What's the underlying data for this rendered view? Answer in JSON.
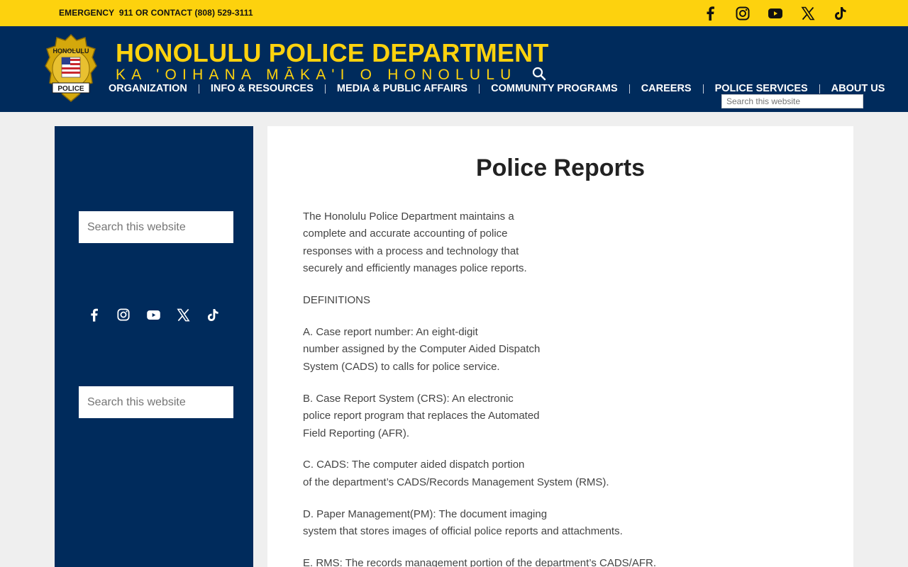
{
  "topbar": {
    "emergency": "EMERGENCY  911 OR CONTACT (808) 529-3111",
    "social": [
      "facebook-icon",
      "instagram-icon",
      "youtube-icon",
      "x-icon",
      "tiktok-icon"
    ]
  },
  "header": {
    "title": "HONOLULU POLICE DEPARTMENT",
    "subtitle": "KA 'OIHANA MĀKA'I O HONOLULU",
    "search_placeholder": "Search this website",
    "nav": [
      {
        "label": "ORGANIZATION"
      },
      {
        "label": "INFO & RESOURCES"
      },
      {
        "label": "MEDIA & PUBLIC AFFAIRS"
      },
      {
        "label": "COMMUNITY PROGRAMS"
      },
      {
        "label": "CAREERS"
      },
      {
        "label": "POLICE SERVICES"
      },
      {
        "label": "ABOUT US"
      }
    ],
    "logo_text_top": "HONOLULU",
    "logo_text_bottom": "POLICE"
  },
  "sidebar": {
    "search1_placeholder": "Search this website",
    "search2_placeholder": "Search this website"
  },
  "main": {
    "title": "Police Reports",
    "paragraphs": [
      [
        "The Honolulu Police Department maintains a",
        "complete and accurate accounting of police",
        "responses with a process and technology that",
        "securely and efficiently manages police reports."
      ],
      [
        "DEFINITIONS"
      ],
      [
        "A. Case report number: An eight-digit",
        "number assigned by the Computer Aided Dispatch",
        "System (CADS) to calls for police service."
      ],
      [
        "B. Case Report System (CRS): An electronic",
        "police report program that replaces the Automated",
        "Field Reporting (AFR)."
      ],
      [
        "C. CADS: The computer aided dispatch portion",
        "of the department’s CADS/Records Management System (RMS)."
      ],
      [
        "D. Paper Management(PM): The document imaging",
        "system that stores images of official police reports and attachments."
      ],
      [
        "E. RMS: The records management portion of the department’s CADS/AFR."
      ]
    ]
  },
  "colors": {
    "navy": "#002b5c",
    "gold": "#fdd20e"
  }
}
